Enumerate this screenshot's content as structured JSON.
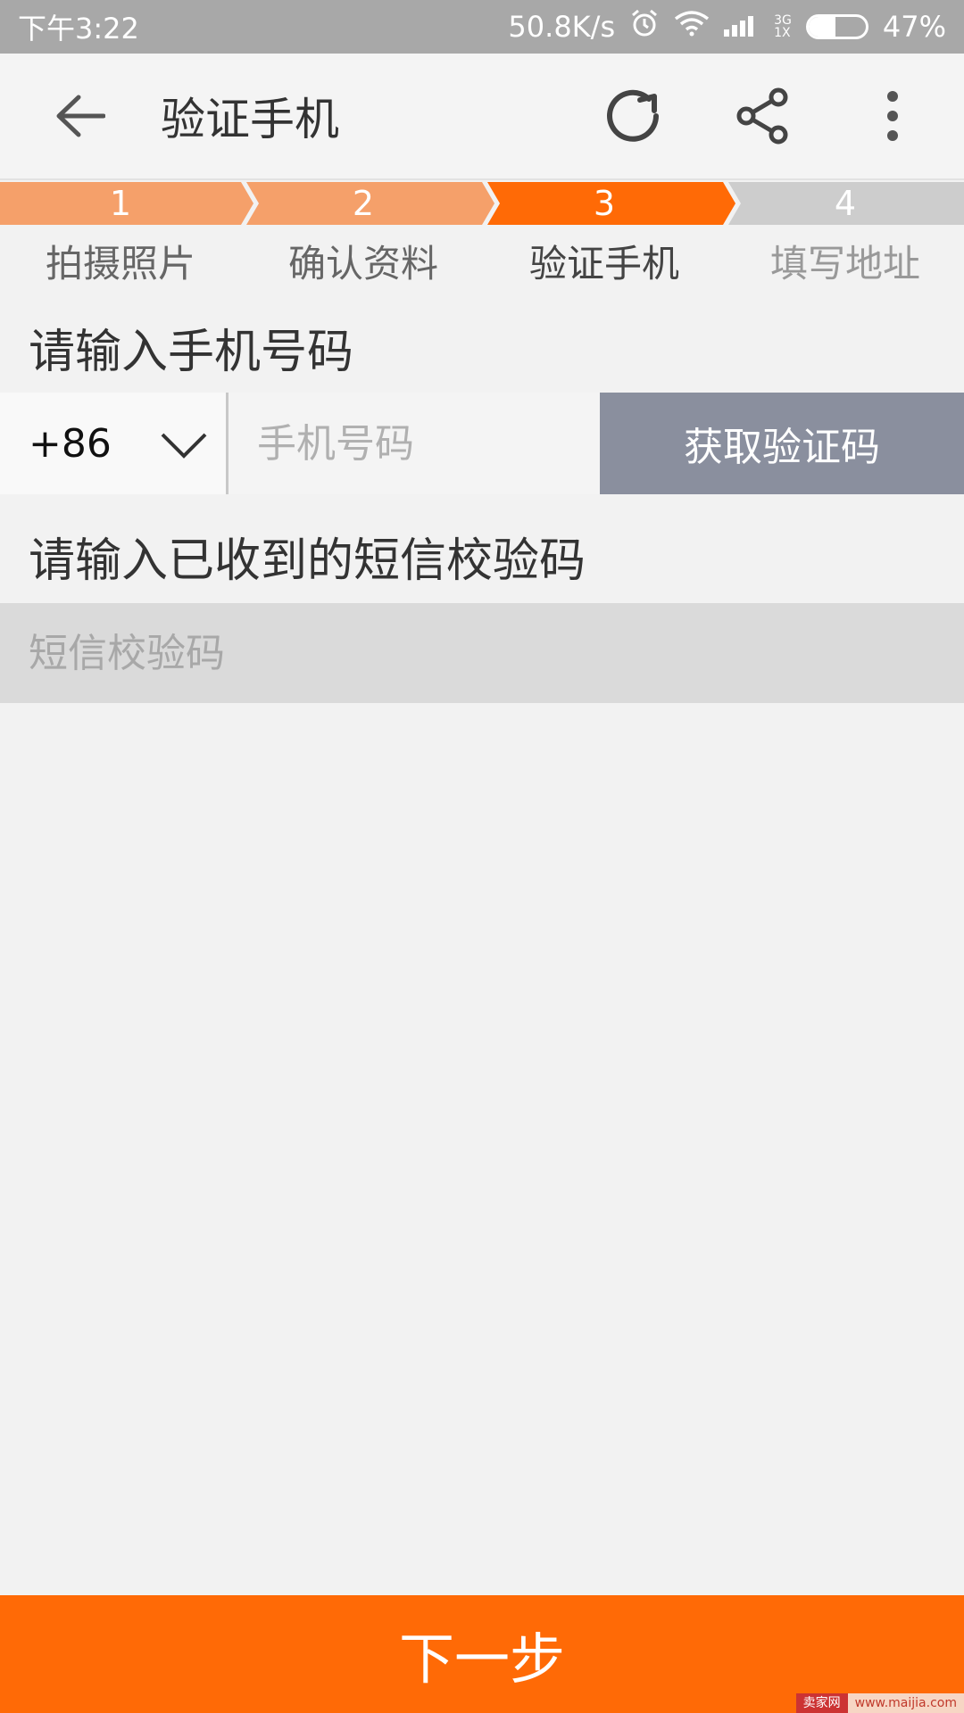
{
  "status_bar": {
    "time": "下午3:22",
    "speed": "50.8K/s",
    "network_top": "3G",
    "network_bottom": "1X",
    "battery": "47%",
    "battery_level": 0.47
  },
  "toolbar": {
    "title": "验证手机"
  },
  "steps": {
    "items": [
      {
        "number": "1",
        "label": "拍摄照片",
        "state": "done"
      },
      {
        "number": "2",
        "label": "确认资料",
        "state": "done"
      },
      {
        "number": "3",
        "label": "验证手机",
        "state": "active"
      },
      {
        "number": "4",
        "label": "填写地址",
        "state": "pending"
      }
    ],
    "colors": {
      "done": "#f5a06a",
      "active": "#ff6a06",
      "pending": "#cdcdcd"
    }
  },
  "phone_section": {
    "label": "请输入手机号码",
    "country_code": "+86",
    "phone_placeholder": "手机号码",
    "get_code_label": "获取验证码"
  },
  "sms_section": {
    "label": "请输入已收到的短信校验码",
    "sms_placeholder": "短信校验码"
  },
  "footer": {
    "next_label": "下一步"
  },
  "watermark": {
    "left": "卖家网",
    "right": "www.maijia.com"
  }
}
